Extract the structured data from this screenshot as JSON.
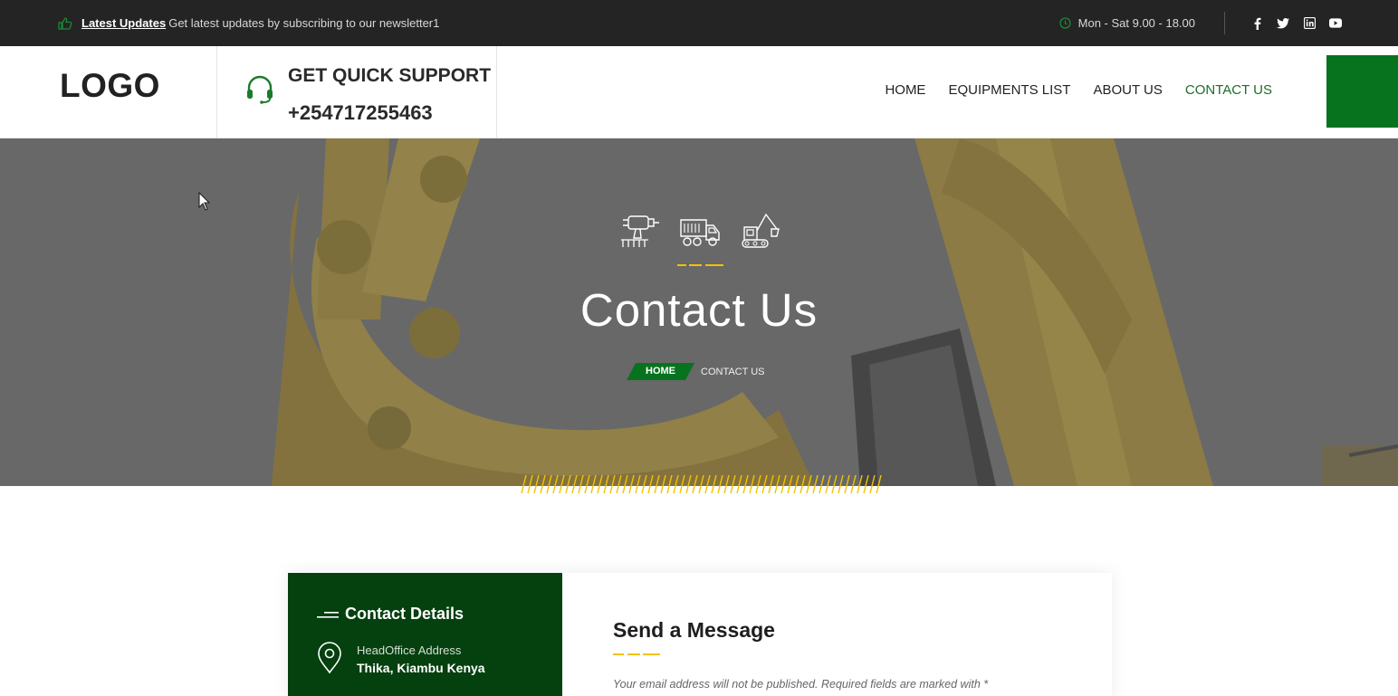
{
  "topbar": {
    "updates_link": "Latest Updates",
    "updates_text": "Get latest updates by subscribing to our newsletter1",
    "hours": "Mon - Sat 9.00 - 18.00",
    "social": [
      "facebook-icon",
      "twitter-icon",
      "linkedin-icon",
      "youtube-icon"
    ]
  },
  "header": {
    "logo": "LOGO",
    "support_title": "GET QUICK SUPPORT",
    "support_phone": "+254717255463",
    "nav": [
      "HOME",
      "EQUIPMENTS LIST",
      "ABOUT US",
      "CONTACT US"
    ],
    "active_nav": "CONTACT US"
  },
  "hero": {
    "icons": [
      "drill-icon",
      "dump-truck-icon",
      "excavator-icon"
    ],
    "title": "Contact Us",
    "breadcrumb_home": "HOME",
    "breadcrumb_current": "CONTACT US"
  },
  "contact": {
    "details_title": "Contact Details",
    "address_label": "HeadOffice Address",
    "address_value": "Thika, Kiambu Kenya"
  },
  "message": {
    "title": "Send a Message",
    "note": "Your email address will not be published. Required fields are marked with *"
  },
  "colors": {
    "brand_green": "#08731f",
    "dark_green": "#05400f",
    "accent_yellow": "#f2c200",
    "topbar_bg": "#242424"
  }
}
